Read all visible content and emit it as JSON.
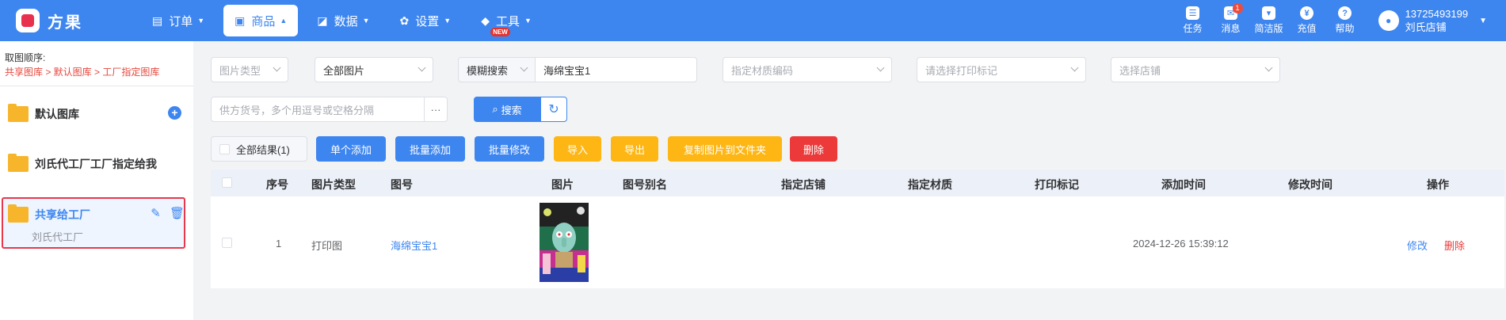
{
  "app": {
    "name": "方果"
  },
  "nav": [
    {
      "label": "订单",
      "icon": "receipt-icon"
    },
    {
      "label": "商品",
      "icon": "shopping-bag-icon"
    },
    {
      "label": "数据",
      "icon": "chart-icon"
    },
    {
      "label": "设置",
      "icon": "gear-icon"
    },
    {
      "label": "工具",
      "icon": "cube-icon",
      "badge": "NEW"
    }
  ],
  "tools": [
    {
      "label": "任务"
    },
    {
      "label": "消息",
      "badge": "1"
    },
    {
      "label": "简洁版"
    },
    {
      "label": "充值"
    },
    {
      "label": "帮助"
    }
  ],
  "user": {
    "phone": "13725493199",
    "shop": "刘氏店铺"
  },
  "sidebar": {
    "order_title": "取图顺序:",
    "order_path": "共享图库 > 默认图库 > 工厂指定图库",
    "folders": [
      {
        "label": "默认图库"
      },
      {
        "label": "刘氏代工厂工厂指定给我"
      },
      {
        "label": "共享给工厂",
        "sub": "刘氏代工厂"
      }
    ]
  },
  "filters": {
    "image_type": "图片类型",
    "all_images": "全部图片",
    "search_mode": "模糊搜索",
    "search_value": "海绵宝宝1",
    "material": "指定材质编码",
    "print_mark": "请选择打印标记",
    "shop": "选择店铺",
    "supplier": "供方货号，多个用逗号或空格分隔",
    "more": "···",
    "search_btn": "搜索"
  },
  "actions": {
    "all_results": "全部结果(1)",
    "single_add": "单个添加",
    "batch_add": "批量添加",
    "batch_edit": "批量修改",
    "import": "导入",
    "export": "导出",
    "copy_to_folder": "复制图片到文件夹",
    "delete": "删除"
  },
  "table": {
    "columns": [
      "序号",
      "图片类型",
      "图号",
      "图片",
      "图号别名",
      "指定店铺",
      "指定材质",
      "打印标记",
      "添加时间",
      "修改时间",
      "操作"
    ],
    "rows": [
      {
        "index": "1",
        "type": "打印图",
        "code": "海绵宝宝1",
        "alias": "",
        "shop": "",
        "material": "",
        "print_mark": "",
        "added": "2024-12-26 15:39:12",
        "modified": "",
        "edit": "修改",
        "delete": "删除"
      }
    ]
  },
  "colors": {
    "primary": "#3e86ef",
    "warning": "#fdb614",
    "danger": "#ec3a3a",
    "folder": "#f7b52c"
  }
}
